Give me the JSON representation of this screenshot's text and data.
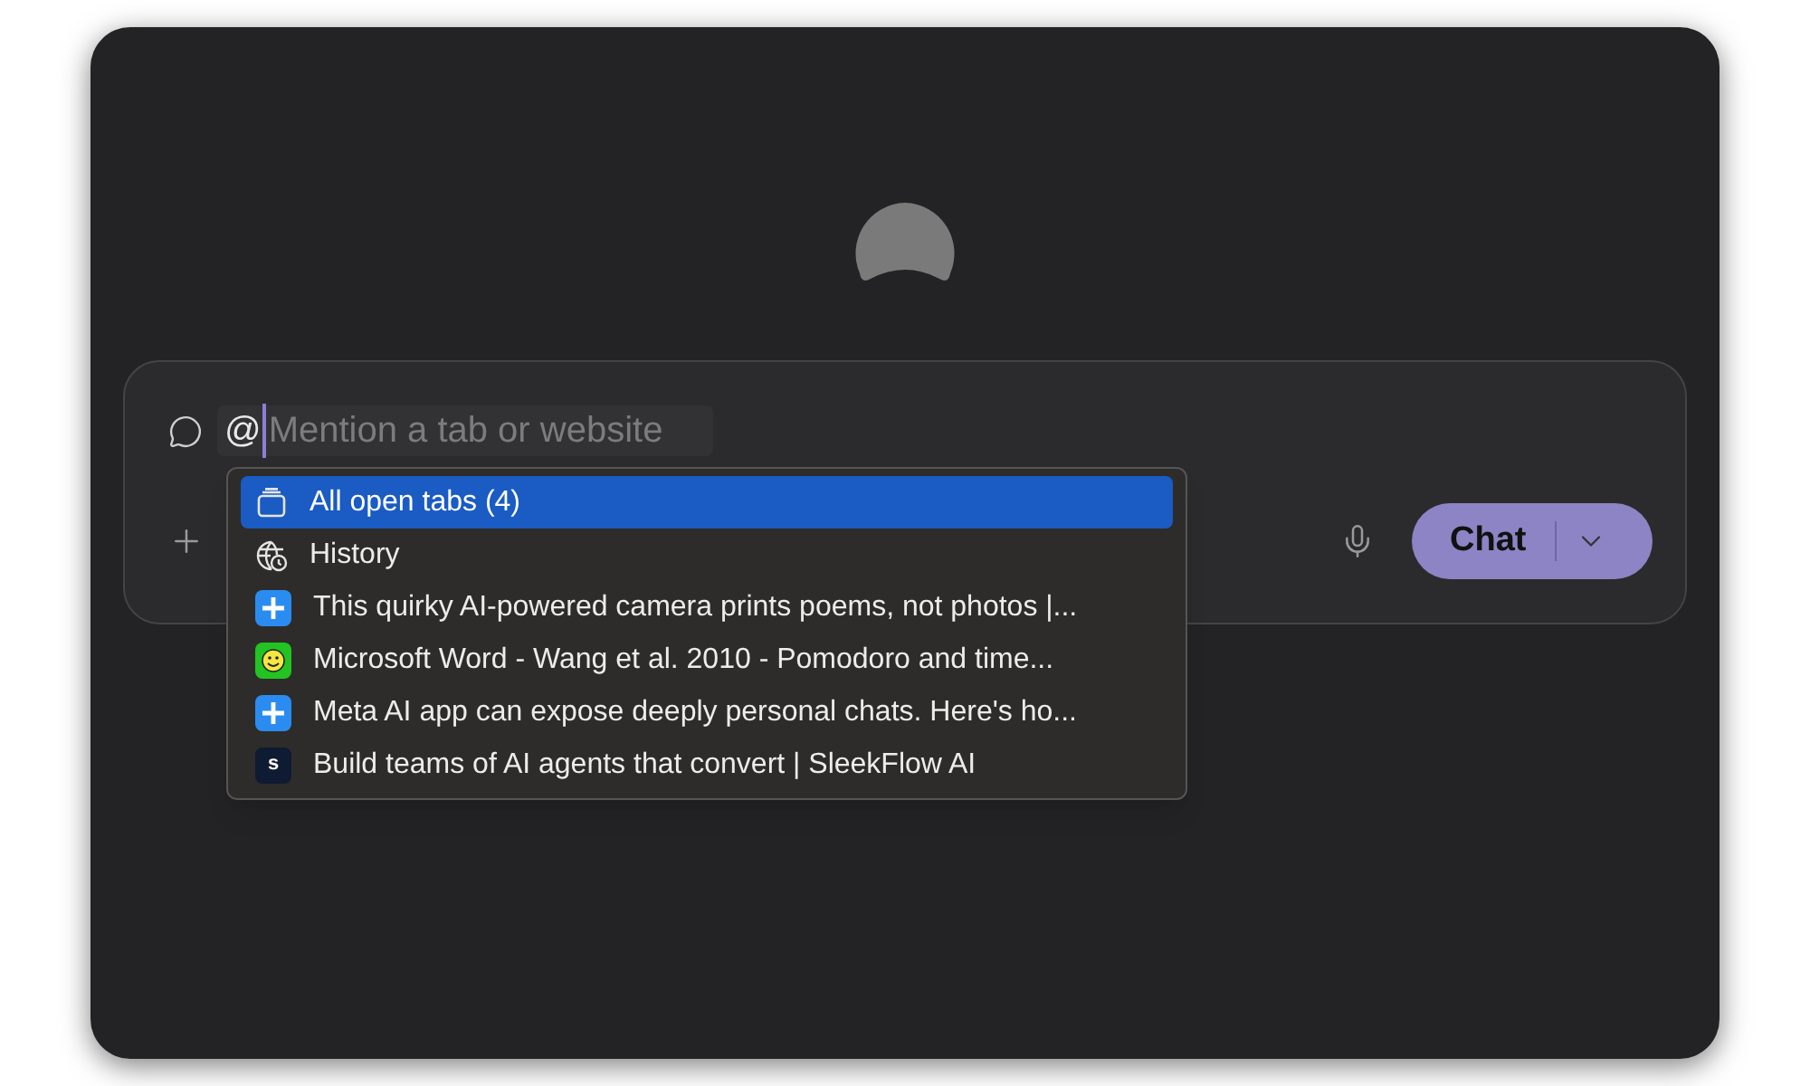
{
  "composer": {
    "mention": "@",
    "placeholder": "Mention a tab or website",
    "chat_button": "Chat"
  },
  "menu": [
    {
      "kind": "all-tabs",
      "label": "All open tabs (4)",
      "selected": true
    },
    {
      "kind": "history",
      "label": "History",
      "selected": false
    },
    {
      "kind": "tab",
      "favicon": {
        "kind": "plus"
      },
      "label": "This quirky AI-powered camera prints poems, not photos |...",
      "selected": false
    },
    {
      "kind": "tab",
      "favicon": {
        "kind": "smiley"
      },
      "label": "Microsoft Word - Wang et al. 2010 - Pomodoro and time...",
      "selected": false
    },
    {
      "kind": "tab",
      "favicon": {
        "kind": "plus"
      },
      "label": "Meta AI app can expose deeply personal chats. Here's ho...",
      "selected": false
    },
    {
      "kind": "tab",
      "favicon": {
        "kind": "letter",
        "letter": "s"
      },
      "label": "Build teams of AI agents that convert | SleekFlow AI",
      "selected": false
    }
  ]
}
